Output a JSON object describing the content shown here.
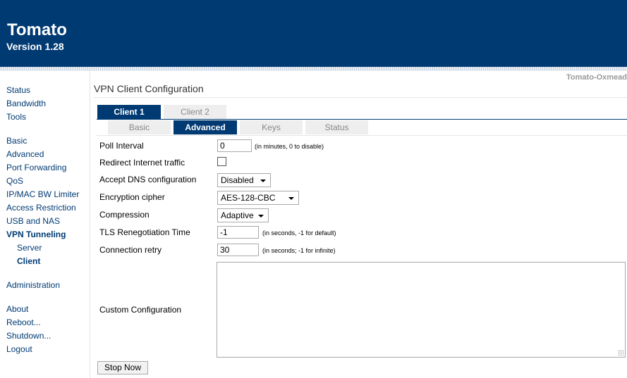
{
  "header": {
    "title": "Tomato",
    "version": "Version 1.28"
  },
  "brand": "Tomato-Oxmead",
  "sidebar": {
    "items": [
      {
        "label": "Status"
      },
      {
        "label": "Bandwidth"
      },
      {
        "label": "Tools"
      },
      {
        "label": "Basic"
      },
      {
        "label": "Advanced"
      },
      {
        "label": "Port Forwarding"
      },
      {
        "label": "QoS"
      },
      {
        "label": "IP/MAC BW Limiter"
      },
      {
        "label": "Access Restriction"
      },
      {
        "label": "USB and NAS"
      },
      {
        "label": "VPN Tunneling"
      },
      {
        "label": "Server"
      },
      {
        "label": "Client"
      },
      {
        "label": "Administration"
      },
      {
        "label": "About"
      },
      {
        "label": "Reboot..."
      },
      {
        "label": "Shutdown..."
      },
      {
        "label": "Logout"
      }
    ]
  },
  "page_title": "VPN Client Configuration",
  "client_tabs": [
    "Client 1",
    "Client 2"
  ],
  "sub_tabs": [
    "Basic",
    "Advanced",
    "Keys",
    "Status"
  ],
  "form": {
    "poll_interval": {
      "label": "Poll Interval",
      "value": "0",
      "hint": "(in minutes, 0 to disable)"
    },
    "redirect": {
      "label": "Redirect Internet traffic",
      "checked": false
    },
    "accept_dns": {
      "label": "Accept DNS configuration",
      "value": "Disabled"
    },
    "cipher": {
      "label": "Encryption cipher",
      "value": "AES-128-CBC"
    },
    "compression": {
      "label": "Compression",
      "value": "Adaptive"
    },
    "tls": {
      "label": "TLS Renegotiation Time",
      "value": "-1",
      "hint": "(in seconds, -1 for default)"
    },
    "retry": {
      "label": "Connection retry",
      "value": "30",
      "hint": "(in seconds; -1 for infinite)"
    },
    "custom": {
      "label": "Custom Configuration",
      "value": ""
    }
  },
  "stop_button": "Stop Now",
  "colors": {
    "header": "#003a73",
    "active_tab": "#003a73",
    "link": "#003a73"
  }
}
